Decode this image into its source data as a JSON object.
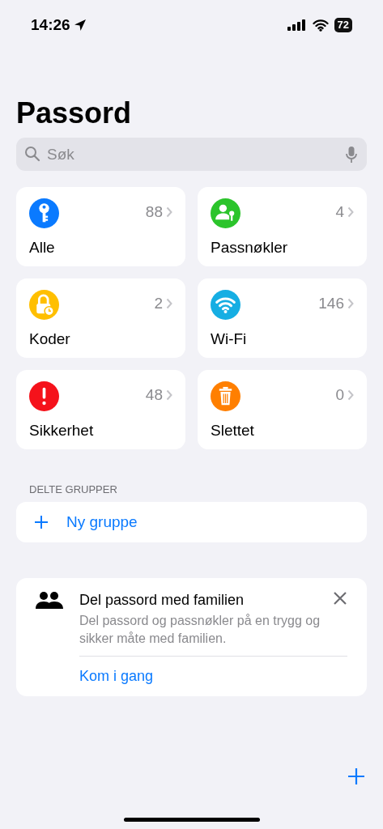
{
  "status_bar": {
    "time": "14:26",
    "battery": "72"
  },
  "title": "Passord",
  "search": {
    "placeholder": "Søk"
  },
  "categories": [
    {
      "kind": "key",
      "label": "Alle",
      "count": "88",
      "color": "#0a7aff"
    },
    {
      "kind": "passkey",
      "label": "Passnøkler",
      "count": "4",
      "color": "#2bc42b"
    },
    {
      "kind": "code",
      "label": "Koder",
      "count": "2",
      "color": "#ffbf00"
    },
    {
      "kind": "wifi",
      "label": "Wi-Fi",
      "count": "146",
      "color": "#16aee3"
    },
    {
      "kind": "alert",
      "label": "Sikkerhet",
      "count": "48",
      "color": "#f5121b"
    },
    {
      "kind": "trash",
      "label": "Slettet",
      "count": "0",
      "color": "#ff7f00"
    }
  ],
  "shared_groups": {
    "header": "DELTE GRUPPER",
    "new_group": "Ny gruppe"
  },
  "family_card": {
    "title": "Del passord med familien",
    "text": "Del passord og passnøkler på en trygg og sikker måte med familien.",
    "action": "Kom i gang"
  }
}
